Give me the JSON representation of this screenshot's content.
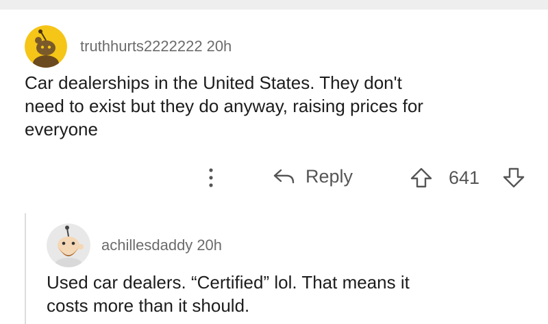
{
  "colors": {
    "avatar1_bg": "#f5c518",
    "avatar2_bg": "#e8e8e8",
    "meta_text": "#6b6b6b",
    "action_text": "#555555"
  },
  "comment1": {
    "avatar_icon": "snoo-avatar-yellow",
    "username": "truthhurts2222222",
    "time": "20h",
    "body_lines": [
      "Car dealerships in the United States. They don't",
      "need to exist but they do anyway, raising prices for",
      "everyone"
    ],
    "actions": {
      "more_icon": "more-vertical-icon",
      "reply_icon": "reply-arrow-icon",
      "reply_label": "Reply",
      "upvote_icon": "upvote-arrow-icon",
      "score": "641",
      "downvote_icon": "downvote-arrow-icon"
    }
  },
  "comment2": {
    "avatar_icon": "snoo-avatar-bearded",
    "username": "achillesdaddy",
    "time": "20h",
    "body_lines": [
      "Used car dealers. “Certified” lol. That means it",
      "costs more than it should."
    ]
  }
}
